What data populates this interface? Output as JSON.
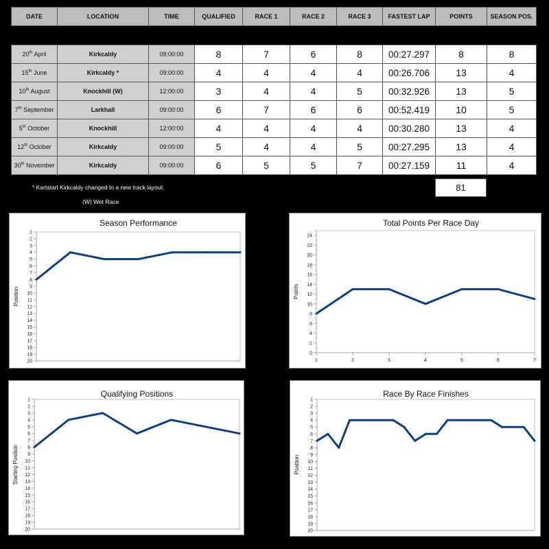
{
  "table": {
    "headers": [
      "DATE",
      "LOCATION",
      "TIME",
      "QUALIFIED",
      "RACE 1",
      "RACE 2",
      "RACE 3",
      "FASTEST LAP",
      "POINTS",
      "SEASON POS."
    ],
    "rows": [
      {
        "day": "20",
        "suffix": "th",
        "month": "April",
        "location": "Kirkcaldy",
        "time": "09:00:00",
        "qualified": "8",
        "race1": "7",
        "race2": "6",
        "race3": "8",
        "fastest_lap": "00:27.297",
        "points": "8",
        "season_pos": "8"
      },
      {
        "day": "15",
        "suffix": "th",
        "month": "June",
        "location": "Kirkcaldy *",
        "time": "09:00:00",
        "qualified": "4",
        "race1": "4",
        "race2": "4",
        "race3": "4",
        "fastest_lap": "00:26.706",
        "points": "13",
        "season_pos": "4"
      },
      {
        "day": "10",
        "suffix": "th",
        "month": "August",
        "location": "Knockhill (W)",
        "time": "12:00:00",
        "qualified": "3",
        "race1": "4",
        "race2": "4",
        "race3": "5",
        "fastest_lap": "00:32.926",
        "points": "13",
        "season_pos": "5"
      },
      {
        "day": "7",
        "suffix": "th",
        "month": "September",
        "location": "Larkhall",
        "time": "09:00:00",
        "qualified": "6",
        "race1": "7",
        "race2": "6",
        "race3": "6",
        "fastest_lap": "00:52.419",
        "points": "10",
        "season_pos": "5"
      },
      {
        "day": "5",
        "suffix": "th",
        "month": "October",
        "location": "Knockhill",
        "time": "12:00:00",
        "qualified": "4",
        "race1": "4",
        "race2": "4",
        "race3": "4",
        "fastest_lap": "00:30.280",
        "points": "13",
        "season_pos": "4"
      },
      {
        "day": "12",
        "suffix": "th",
        "month": "October",
        "location": "Kirkcaldy",
        "time": "09:00:00",
        "qualified": "5",
        "race1": "4",
        "race2": "4",
        "race3": "5",
        "fastest_lap": "00:27.295",
        "points": "13",
        "season_pos": "4"
      },
      {
        "day": "30",
        "suffix": "th",
        "month": "November",
        "location": "Kirkcaldy",
        "time": "09:00:00",
        "qualified": "6",
        "race1": "5",
        "race2": "5",
        "race3": "7",
        "fastest_lap": "00:27.159",
        "points": "11",
        "season_pos": "4"
      }
    ],
    "points_total": "81"
  },
  "notes": {
    "track_change": "* Kartstart Kirkcaldy changed to a new track layout.",
    "wet_race": "(W) Wet Race"
  },
  "colors": {
    "line": "#0d3f7f",
    "grid_border": "#cccccc"
  },
  "chart_data": [
    {
      "type": "line",
      "title": "Season Performance",
      "xlabel": "",
      "ylabel": "Position",
      "x": [
        1,
        2,
        3,
        4,
        5,
        6,
        7
      ],
      "values": [
        8,
        4,
        5,
        5,
        4,
        4,
        4
      ],
      "ylim": [
        1,
        20
      ],
      "y_inverted": true,
      "y_ticks": [
        1,
        2,
        3,
        4,
        5,
        6,
        7,
        8,
        9,
        10,
        11,
        12,
        13,
        14,
        15,
        16,
        17,
        18,
        19,
        20
      ],
      "x_tick_labels": [],
      "grid": false
    },
    {
      "type": "line",
      "title": "Total Points Per Race Day",
      "xlabel": "",
      "ylabel": "Points",
      "x": [
        1,
        2,
        3,
        4,
        5,
        6,
        7
      ],
      "values": [
        8,
        13,
        13,
        10,
        13,
        13,
        11
      ],
      "ylim": [
        0,
        24
      ],
      "y_inverted": false,
      "y_ticks": [
        0,
        2,
        4,
        6,
        8,
        10,
        12,
        14,
        16,
        18,
        20,
        22,
        24
      ],
      "x_tick_labels": [
        "1",
        "2",
        "3",
        "4",
        "5",
        "6",
        "7"
      ],
      "grid": false
    },
    {
      "type": "line",
      "title": "Qualifying Positions",
      "xlabel": "",
      "ylabel": "Starting Position",
      "x": [
        1,
        2,
        3,
        4,
        5,
        6,
        7
      ],
      "values": [
        8,
        4,
        3,
        6,
        4,
        5,
        6
      ],
      "ylim": [
        1,
        20
      ],
      "y_inverted": true,
      "y_ticks": [
        1,
        2,
        3,
        4,
        5,
        6,
        7,
        8,
        9,
        10,
        11,
        12,
        13,
        14,
        15,
        16,
        17,
        18,
        19,
        20
      ],
      "x_tick_labels": [],
      "grid": false
    },
    {
      "type": "line",
      "title": "Race By Race Finishes",
      "xlabel": "",
      "ylabel": "Position",
      "x": [
        1,
        2,
        3,
        4,
        5,
        6,
        7,
        8,
        9,
        10,
        11,
        12,
        13,
        14,
        15,
        16,
        17,
        18,
        19,
        20,
        21
      ],
      "values": [
        7,
        6,
        8,
        4,
        4,
        4,
        4,
        4,
        5,
        7,
        6,
        6,
        4,
        4,
        4,
        4,
        4,
        5,
        5,
        5,
        7
      ],
      "ylim": [
        1,
        20
      ],
      "y_inverted": true,
      "y_ticks": [
        1,
        2,
        3,
        4,
        5,
        6,
        7,
        8,
        9,
        10,
        11,
        12,
        13,
        14,
        15,
        16,
        17,
        18,
        19,
        20
      ],
      "x_tick_labels": [],
      "grid": false
    }
  ]
}
